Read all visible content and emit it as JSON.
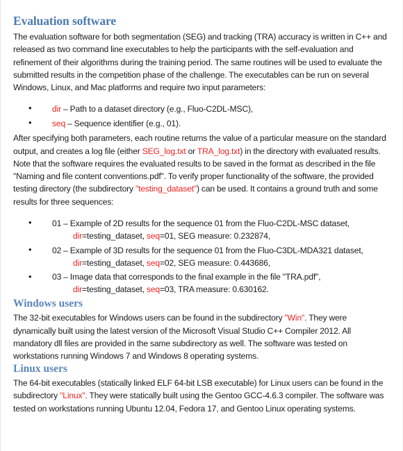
{
  "document": {
    "sections": [
      {
        "id": "evaluation-software",
        "heading": "Evaluation software",
        "intro_paragraph": {
          "parts": [
            {
              "text": "The evaluation software for both segmentation (SEG) and tracking (TRA) accuracy is written in C++ and released as two command line executables to help the participants with the self-evaluation and refinement of their algorithms during the training period. The same routines will be used to evaluate the submitted results in the competition phase of the challenge. The executables can be run on several Windows, Linux, and Mac platforms and require two input parameters:",
              "color": "black"
            }
          ]
        },
        "parameter_list": [
          {
            "code": "dir",
            "description": " – Path to a dataset directory (e.g., Fluo-C2DL-MSC),"
          },
          {
            "code": "seq",
            "description": " – Sequence identifier (e.g., 01)."
          }
        ],
        "detail_paragraph": {
          "parts": [
            {
              "text": "After specifying both parameters, each routine returns the value of a particular measure on the standard output, and creates a log file (either ",
              "color": "black"
            },
            {
              "text": "SEG_log.txt",
              "color": "red"
            },
            {
              "text": " or ",
              "color": "black"
            },
            {
              "text": "TRA_log.txt",
              "color": "red"
            },
            {
              "text": ") in the directory with evaluated results. Note that the software requires the evaluated results to be saved in the format as described in the file \"Naming and file content conventions.pdf\". To verify proper functionality of the software, the provided testing directory (the subdirectory  ",
              "color": "black"
            },
            {
              "text": "\"testing_dataset\"",
              "color": "red"
            },
            {
              "text": ") can be used. It contains a ground truth and some results for three sequences:",
              "color": "black"
            }
          ]
        },
        "sequence_list": [
          {
            "label": "01 – Example of 2D results for the sequence 01 from the Fluo-C2DL-MSC dataset,",
            "cont_parts": [
              {
                "text": "dir",
                "color": "red"
              },
              {
                "text": "=testing_dataset, ",
                "color": "black"
              },
              {
                "text": "seq",
                "color": "red"
              },
              {
                "text": "=01, SEG measure: 0.232874,",
                "color": "black"
              }
            ]
          },
          {
            "label": "02 – Example of 3D results  for  the sequence 01 from the Fluo-C3DL-MDA321 dataset,",
            "cont_parts": [
              {
                "text": "dir",
                "color": "red"
              },
              {
                "text": "=testing_dataset, ",
                "color": "black"
              },
              {
                "text": "seq",
                "color": "red"
              },
              {
                "text": "=02, SEG measure: 0.443686,",
                "color": "black"
              }
            ]
          },
          {
            "label": "03 – Image data that corresponds to the final example in the file \"TRA.pdf\",",
            "cont_parts": [
              {
                "text": "dir",
                "color": "red"
              },
              {
                "text": "=testing_dataset, ",
                "color": "black"
              },
              {
                "text": "seq",
                "color": "red"
              },
              {
                "text": "=03, TRA  measure: 0.630162.",
                "color": "black"
              }
            ]
          }
        ]
      },
      {
        "id": "windows-users",
        "heading": "Windows users",
        "paragraph": {
          "parts": [
            {
              "text": "The 32-bit executables for Windows users can be found in the subdirectory ",
              "color": "black"
            },
            {
              "text": "\"Win\"",
              "color": "red"
            },
            {
              "text": ". They were dynamically built using the latest version of the Microsoft Visual Studio C++ Compiler 2012. All mandatory dll files are provided in the same subdirectory as well. The software was tested on workstations running Windows 7 and Windows 8 operating systems.",
              "color": "black"
            }
          ]
        }
      },
      {
        "id": "linux-users",
        "heading": "Linux users",
        "paragraph": {
          "parts": [
            {
              "text": "The 64-bit executables (statically linked ELF 64-bit LSB executable) for Linux users can be found in the subdirectory ",
              "color": "black"
            },
            {
              "text": "\"Linux\"",
              "color": "red"
            },
            {
              "text": ". They were statically built using the Gentoo GCC-4.6.3 compiler. The software was tested on workstations running Ubuntu 12.04, Fedora 17, and Gentoo Linux operating systems.",
              "color": "black"
            }
          ]
        }
      }
    ]
  },
  "colors": {
    "heading_blue": "#4a7ab0",
    "subheading_blue": "#5b86ba",
    "accent_red": "#ee2222",
    "body_text": "#1a1a1a",
    "page_background": "#ffffff"
  }
}
